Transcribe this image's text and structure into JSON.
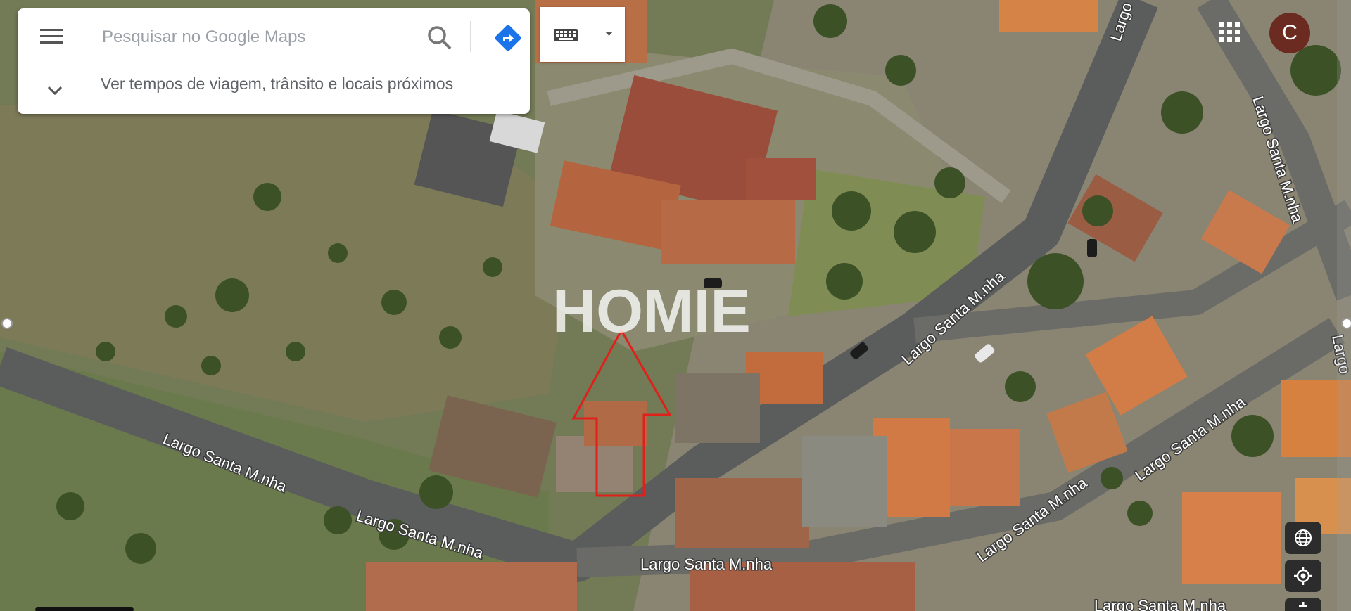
{
  "search": {
    "placeholder": "Pesquisar no Google Maps",
    "info_text": "Ver tempos de viagem, trânsito e locais próximos"
  },
  "account": {
    "initial": "C",
    "avatar_color": "#6b2b20"
  },
  "map": {
    "street_labels": [
      "Largo",
      "Largo Santa M.nha",
      "Largo Santa M.nha",
      "Largo Santa M.nha",
      "Largo Santa M.nha",
      "Largo Santa M.nha",
      "Largo Santa M.nha",
      "Largo Santa M.nha",
      "Largo",
      "Largo Santa M.nha"
    ],
    "watermark": "HOMIE",
    "marker_color": "#e0201a"
  },
  "icons": [
    "menu-icon",
    "search-icon",
    "directions-icon",
    "keyboard-icon",
    "chevron-down-icon",
    "apps-grid-icon",
    "globe-icon",
    "my-location-icon",
    "zoom-in-icon"
  ]
}
